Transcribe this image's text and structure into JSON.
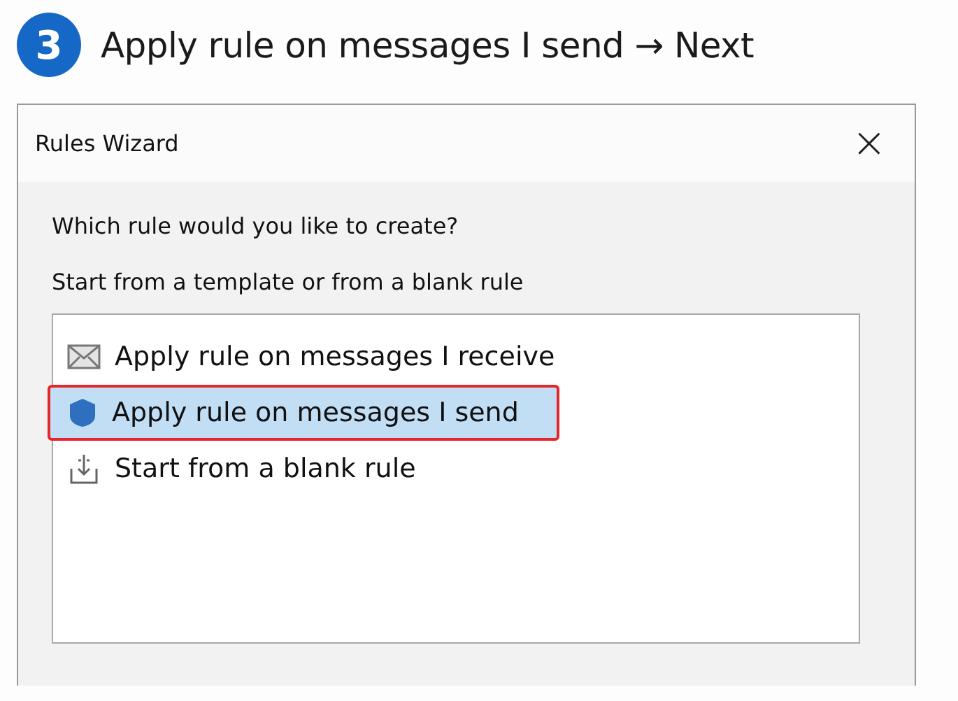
{
  "step": {
    "number": "3",
    "title": "Apply rule on messages I send → Next"
  },
  "window": {
    "title": "Rules Wizard",
    "close": "×"
  },
  "question": "Which rule would you like to create?",
  "subtitle": "Start from a template or from a blank rule",
  "templates": [
    {
      "kind": "receive",
      "label": "Apply rule on messages I receive",
      "selected": false
    },
    {
      "kind": "send",
      "label": "Apply rule on messages I send",
      "selected": true
    },
    {
      "kind": "blank",
      "label": "Start from a blank rule",
      "selected": false
    }
  ]
}
